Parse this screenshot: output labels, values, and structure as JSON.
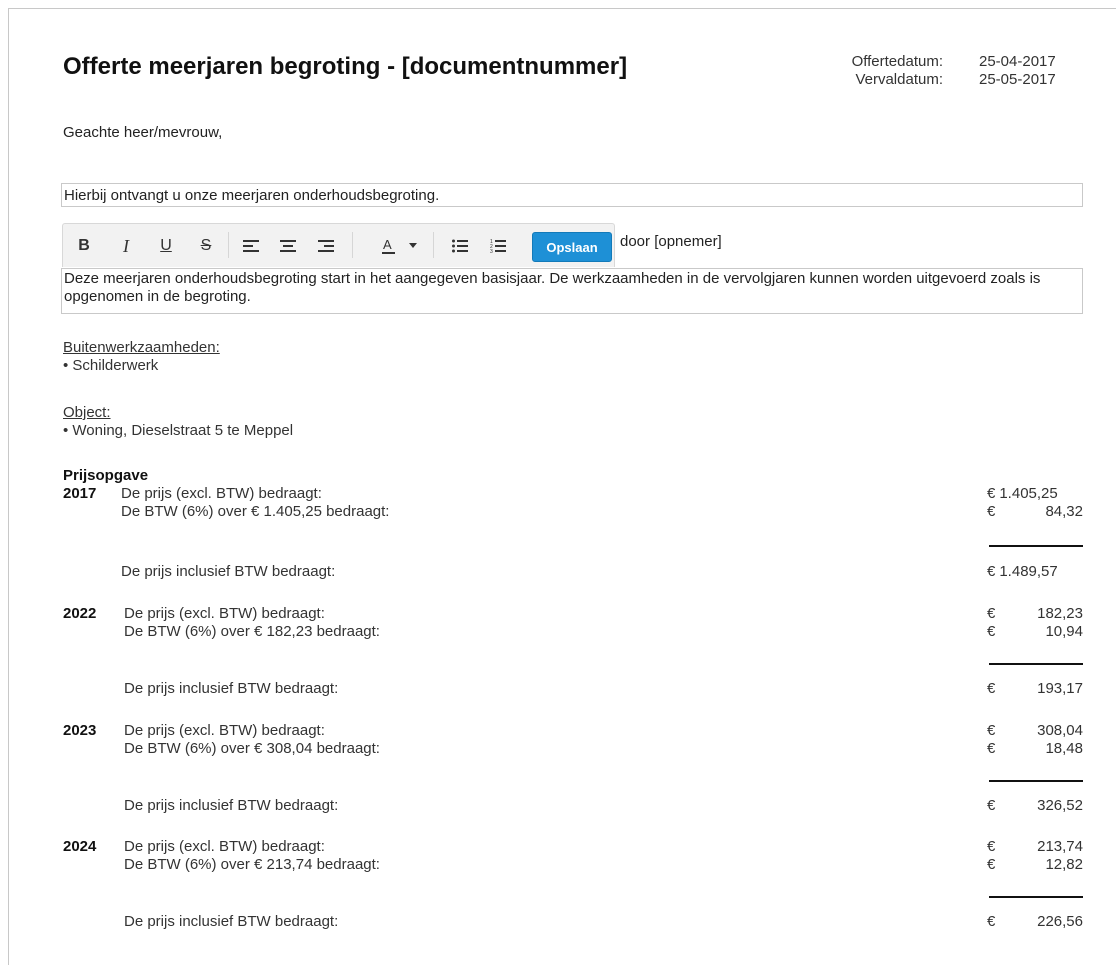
{
  "header": {
    "title": "Offerte meerjaren begroting - [documentnummer]",
    "offer_date_label": "Offertedatum:",
    "offer_date": "25-04-2017",
    "expiry_date_label": "Vervaldatum:",
    "expiry_date": "25-05-2017"
  },
  "salutation": "Geachte heer/mevrouw,",
  "intro_text": "Hierbij ontvangt u onze meerjaren onderhoudsbegroting.",
  "toolbar": {
    "bold_icon": "B",
    "italic_icon": "I",
    "underline_icon": "U",
    "strike_icon": "S",
    "save_label": "Opslaan"
  },
  "door_text": "door [opnemer]",
  "body_text": "Deze meerjaren onderhoudsbegroting start in het aangegeven basisjaar. De werkzaamheden in de vervolgjaren kunnen worden uitgevoerd zoals is opgenomen in de begroting.",
  "sections": {
    "exterior_label": "Buitenwerkzaamheden:",
    "exterior_item": "• Schilderwerk",
    "object_label": "Object:",
    "object_item": "• Woning, Dieselstraat 5 te Meppel"
  },
  "price": {
    "heading": "Prijsopgave",
    "euro": "€",
    "years": [
      {
        "year": "2017",
        "excl_label": "De prijs (excl. BTW) bedraagt:",
        "excl_amount": "1.405,25",
        "vat_label": "De BTW (6%) over € 1.405,25 bedraagt:",
        "vat_amount": "84,32",
        "incl_label": "De prijs inclusief BTW bedraagt:",
        "incl_amount": "1.489,57"
      },
      {
        "year": "2022",
        "excl_label": "De prijs (excl. BTW) bedraagt:",
        "excl_amount": "182,23",
        "vat_label": "De BTW (6%) over € 182,23 bedraagt:",
        "vat_amount": "10,94",
        "incl_label": "De prijs inclusief BTW bedraagt:",
        "incl_amount": "193,17"
      },
      {
        "year": "2023",
        "excl_label": "De prijs (excl. BTW) bedraagt:",
        "excl_amount": "308,04",
        "vat_label": "De BTW (6%) over € 308,04 bedraagt:",
        "vat_amount": "18,48",
        "incl_label": "De prijs inclusief BTW bedraagt:",
        "incl_amount": "326,52"
      },
      {
        "year": "2024",
        "excl_label": "De prijs (excl. BTW) bedraagt:",
        "excl_amount": "213,74",
        "vat_label": "De BTW (6%) over € 213,74 bedraagt:",
        "vat_amount": "12,82",
        "incl_label": "De prijs inclusief BTW bedraagt:",
        "incl_amount": "226,56"
      }
    ]
  },
  "colors": {
    "save_button": "#1e90d6",
    "toolbar_bg": "#f2f2f2",
    "border": "#c9c9c9"
  }
}
